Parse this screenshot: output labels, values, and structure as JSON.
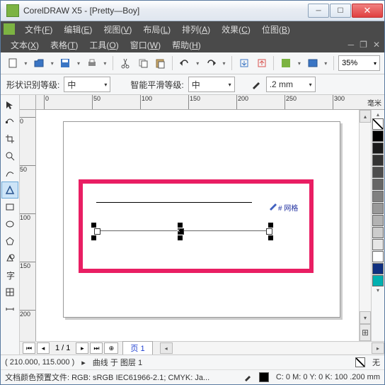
{
  "window": {
    "title": "CorelDRAW X5 - [Pretty—Boy]"
  },
  "menus1": [
    {
      "label": "文件",
      "key": "F"
    },
    {
      "label": "编辑",
      "key": "E"
    },
    {
      "label": "视图",
      "key": "V"
    },
    {
      "label": "布局",
      "key": "L"
    },
    {
      "label": "排列",
      "key": "A"
    },
    {
      "label": "效果",
      "key": "C"
    },
    {
      "label": "位图",
      "key": "B"
    }
  ],
  "menus2": [
    {
      "label": "文本",
      "key": "X"
    },
    {
      "label": "表格",
      "key": "T"
    },
    {
      "label": "工具",
      "key": "O"
    },
    {
      "label": "窗口",
      "key": "W"
    },
    {
      "label": "帮助",
      "key": "H"
    }
  ],
  "toolbar": {
    "zoom": "35%"
  },
  "propbar": {
    "label1": "形状识别等级:",
    "val1": "中",
    "label2": "智能平滑等级:",
    "val2": "中",
    "outline": ".2 mm"
  },
  "ruler": {
    "unit": "毫米",
    "hticks": [
      "0",
      "50",
      "100",
      "150",
      "200",
      "250",
      "300"
    ],
    "vticks": [
      "0",
      "50",
      "100",
      "150",
      "200"
    ]
  },
  "canvas": {
    "hint": "# 网格"
  },
  "pagebar": {
    "range": "1 / 1",
    "tab": "页 1"
  },
  "status": {
    "coords": "( 210.000, 115.000 )",
    "object": "曲线 于 图层 1",
    "fill_label": "无",
    "profile": "文档颜色预置文件: RGB: sRGB IEC61966-2.1; CMYK: Ja...",
    "cmyk": "C: 0 M: 0 Y: 0 K: 100  .200 mm"
  },
  "palette": [
    "#000000",
    "#1a1a1a",
    "#333333",
    "#4d4d4d",
    "#666666",
    "#808080",
    "#999999",
    "#b3b3b3",
    "#cccccc",
    "#e6e6e6",
    "#ffffff",
    "#103080",
    "#00b0b0"
  ]
}
